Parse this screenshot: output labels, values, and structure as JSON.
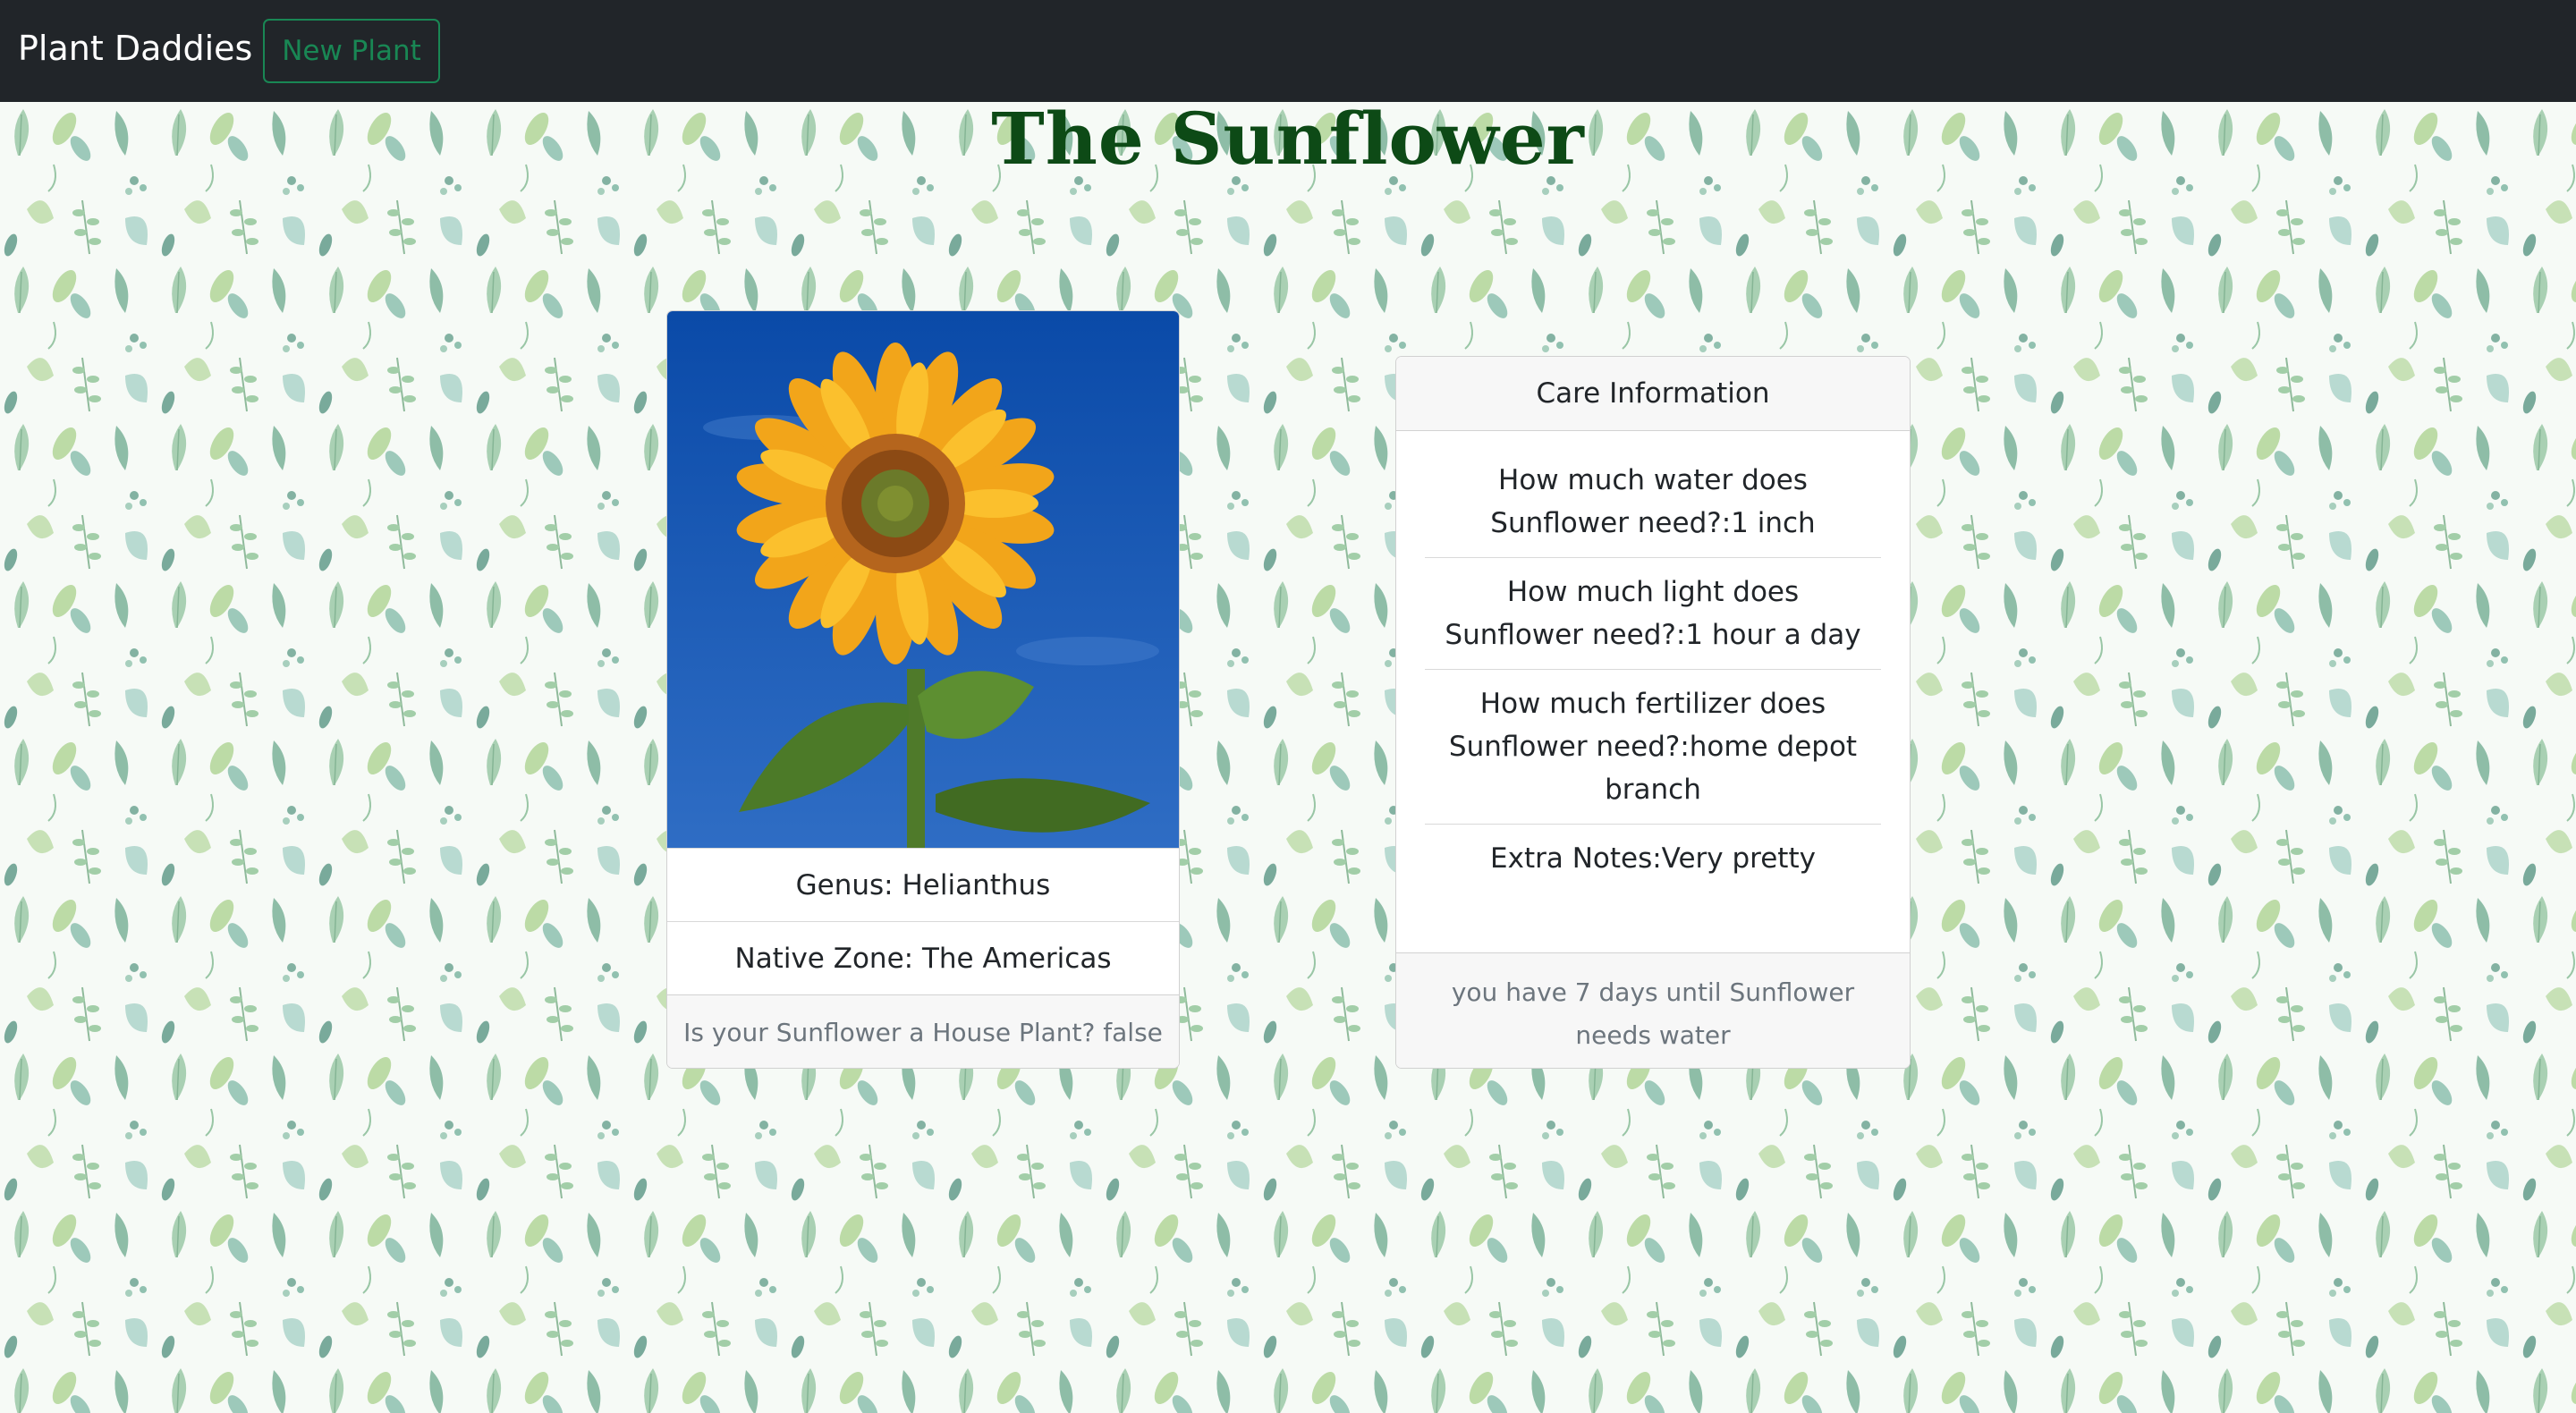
{
  "navbar": {
    "brand": "Plant Daddies",
    "new_plant_label": "New Plant",
    "new_plant_color": "#198754",
    "background": "#212529"
  },
  "page": {
    "title": "The Sunflower",
    "title_color": "#0d4a16",
    "background_pattern": "leaf-pattern"
  },
  "plant_card": {
    "image_icon": "sunflower-photo",
    "genus": "Genus: Helianthus",
    "native_zone": "Native Zone: The Americas",
    "house_plant": "Is your Sunflower a House Plant? false"
  },
  "care_card": {
    "header": "Care Information",
    "items": [
      "How much water does Sunflower need?:1 inch",
      "How much light does Sunflower need?:1 hour a day",
      "How much fertilizer does Sunflower need?:home depot branch",
      "Extra Notes:Very pretty"
    ],
    "footer": "you have 7 days until Sunflower needs water"
  }
}
